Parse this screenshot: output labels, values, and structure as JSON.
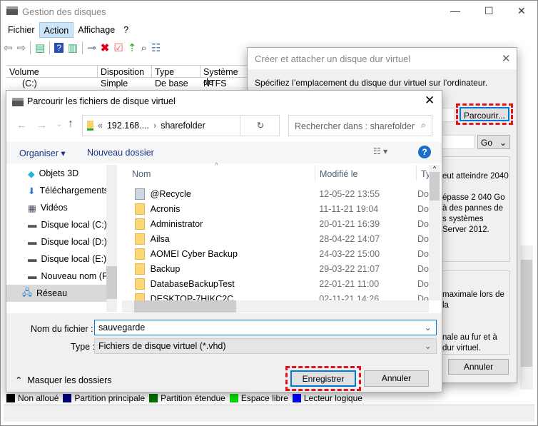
{
  "main": {
    "title": "Gestion des disques",
    "menu": [
      "Fichier",
      "Action",
      "Affichage",
      "?"
    ],
    "columns": [
      "Volume",
      "Disposition",
      "Type",
      "Système de"
    ],
    "row": {
      "volume": "(C:)",
      "disposition": "Simple",
      "type": "De base",
      "fs": "NTFS"
    },
    "legend": [
      {
        "label": "Non alloué",
        "color": "#000000"
      },
      {
        "label": "Partition principale",
        "color": "#00007f"
      },
      {
        "label": "Partition étendue",
        "color": "#007200"
      },
      {
        "label": "Espace libre",
        "color": "#00e000"
      },
      {
        "label": "Lecteur logique",
        "color": "#0000ff"
      }
    ]
  },
  "create_dialog": {
    "title": "Créer et attacher un disque dur virtuel",
    "instruction": "Spécifiez l’emplacement du disque dur virtuel sur l’ordinateur.",
    "browse": "Parcourir...",
    "unit": "Go",
    "text1": [
      "eut atteindre 2040",
      "",
      "épasse 2 040 Go",
      "à des pannes de",
      "s systèmes",
      "Server 2012."
    ],
    "text2": [
      "maximale lors de la",
      "",
      "",
      "nale au fur et à",
      "dur virtuel."
    ],
    "cancel": "Annuler"
  },
  "browse_dialog": {
    "title": "Parcourir les fichiers de disque virtuel",
    "path": [
      "«",
      "192.168....",
      "›",
      "sharefolder"
    ],
    "search_placeholder": "Rechercher dans : sharefolder",
    "organize": "Organiser",
    "new_folder": "Nouveau dossier",
    "nav": [
      {
        "label": "Objets 3D",
        "icon": "cube-icon"
      },
      {
        "label": "Téléchargements",
        "icon": "download-icon"
      },
      {
        "label": "Vidéos",
        "icon": "video-icon"
      },
      {
        "label": "Disque local (C:)",
        "icon": "drive-icon"
      },
      {
        "label": "Disque local (D:)",
        "icon": "drive-icon"
      },
      {
        "label": "Disque local (E:)",
        "icon": "drive-icon"
      },
      {
        "label": "Nouveau nom (F",
        "icon": "drive-icon"
      },
      {
        "label": "Réseau",
        "icon": "network-icon"
      }
    ],
    "columns": [
      "Nom",
      "Modifié le",
      "Ty"
    ],
    "files": [
      {
        "name": "@Recycle",
        "date": "12-05-22 13:55",
        "type": "Do"
      },
      {
        "name": "Acronis",
        "date": "11-11-21 19:04",
        "type": "Do"
      },
      {
        "name": "Administrator",
        "date": "20-01-21 16:39",
        "type": "Do"
      },
      {
        "name": "Ailsa",
        "date": "28-04-22 14:07",
        "type": "Do"
      },
      {
        "name": "AOMEI Cyber Backup",
        "date": "24-03-22 15:00",
        "type": "Do"
      },
      {
        "name": "Backup",
        "date": "29-03-22 21:07",
        "type": "Do"
      },
      {
        "name": "DatabaseBackupTest",
        "date": "22-01-21 11:00",
        "type": "Do"
      },
      {
        "name": "DESKTOP-7HIKC2C",
        "date": "02-11-21 14:26",
        "type": "Do"
      }
    ],
    "filename_label": "Nom du fichier :",
    "filename": "sauvegarde",
    "type_label": "Type :",
    "type_value": "Fichiers de disque virtuel (*.vhd)",
    "hide_folders": "Masquer les dossiers",
    "save": "Enregistrer",
    "cancel": "Annuler"
  }
}
